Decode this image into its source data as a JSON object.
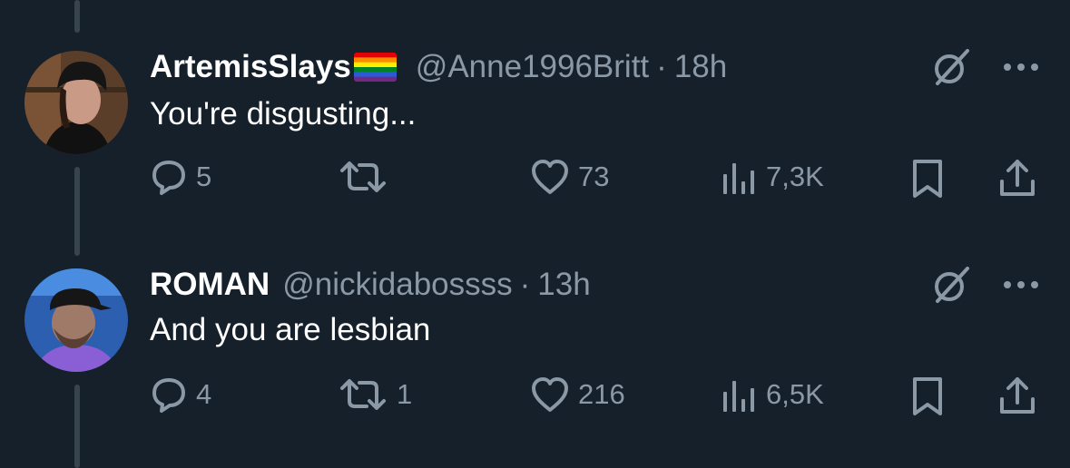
{
  "colors": {
    "background": "#15202b",
    "text_primary": "#ffffff",
    "text_secondary": "#8b98a5",
    "thread_line": "#38444d"
  },
  "tweets": [
    {
      "display_name": "ArtemisSlays",
      "badge_icon": "rainbow-flag-emoji",
      "handle": "@Anne1996Britt",
      "separator": "·",
      "time": "18h",
      "text": "You're disgusting...",
      "reply_count": "5",
      "retweet_count": "",
      "like_count": "73",
      "view_count": "7,3K"
    },
    {
      "display_name": "ROMAN",
      "handle": "@nickidabossss",
      "separator": "·",
      "time": "13h",
      "text": "And you are lesbian",
      "reply_count": "4",
      "retweet_count": "1",
      "like_count": "216",
      "view_count": "6,5K"
    }
  ]
}
